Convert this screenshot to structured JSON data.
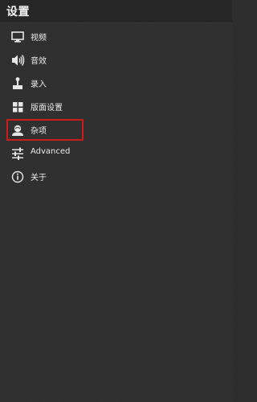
{
  "header": {
    "title": "设置"
  },
  "menu": {
    "items": [
      {
        "label": "视频",
        "icon": "monitor-icon"
      },
      {
        "label": "音效",
        "icon": "speaker-icon"
      },
      {
        "label": "录入",
        "icon": "joystick-icon"
      },
      {
        "label": "版面设置",
        "icon": "grid-icon"
      },
      {
        "label": "杂项",
        "icon": "user-icon"
      },
      {
        "label": "Advanced",
        "icon": "sliders-icon"
      },
      {
        "label": "关于",
        "icon": "info-icon"
      }
    ]
  },
  "highlight": {
    "item": "杂项",
    "color": "#cc1d1d"
  }
}
